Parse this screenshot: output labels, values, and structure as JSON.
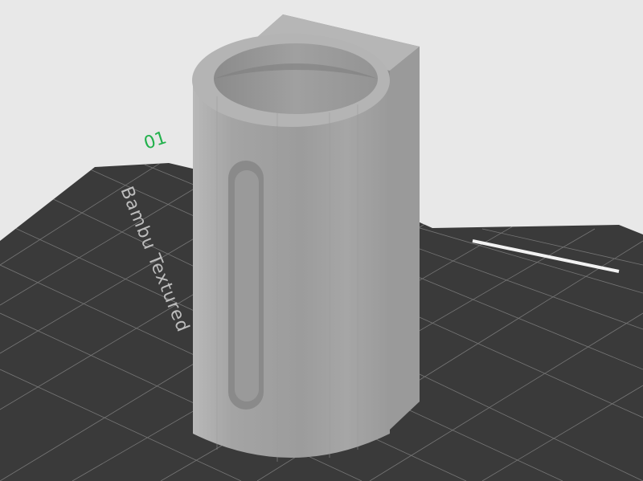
{
  "viewport": {
    "plate_label": "Bambu Textured",
    "plate_number": "01"
  },
  "colors": {
    "background": "#e8e8e8",
    "plate": "#3a3a3a",
    "grid": "#8a8a8a",
    "model": "#a6a6a6",
    "accent_green": "#22b14c"
  },
  "icons": {
    "plate_number": "plate-number-marker"
  }
}
